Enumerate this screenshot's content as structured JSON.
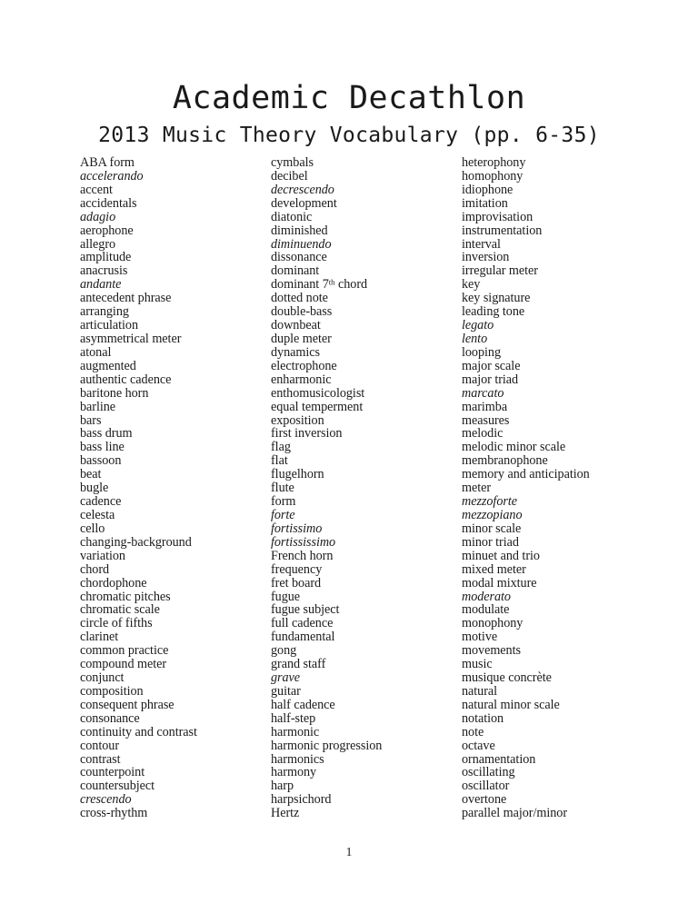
{
  "document": {
    "title": "Academic Decathlon",
    "subtitle": "2013 Music Theory Vocabulary (pp. 6-35)",
    "page_number": "1"
  },
  "columns": [
    {
      "name": "column-1",
      "terms": [
        {
          "text": "ABA form",
          "italic": false
        },
        {
          "text": "accelerando",
          "italic": true
        },
        {
          "text": "accent",
          "italic": false
        },
        {
          "text": "accidentals",
          "italic": false
        },
        {
          "text": "adagio",
          "italic": true
        },
        {
          "text": "aerophone",
          "italic": false
        },
        {
          "text": "allegro",
          "italic": false
        },
        {
          "text": "amplitude",
          "italic": false
        },
        {
          "text": "anacrusis",
          "italic": false
        },
        {
          "text": "andante",
          "italic": true
        },
        {
          "text": "antecedent phrase",
          "italic": false
        },
        {
          "text": "arranging",
          "italic": false
        },
        {
          "text": "articulation",
          "italic": false
        },
        {
          "text": "asymmetrical meter",
          "italic": false
        },
        {
          "text": "atonal",
          "italic": false
        },
        {
          "text": "augmented",
          "italic": false
        },
        {
          "text": "authentic cadence",
          "italic": false
        },
        {
          "text": "baritone horn",
          "italic": false
        },
        {
          "text": "barline",
          "italic": false
        },
        {
          "text": "bars",
          "italic": false
        },
        {
          "text": "bass drum",
          "italic": false
        },
        {
          "text": "bass line",
          "italic": false
        },
        {
          "text": "bassoon",
          "italic": false
        },
        {
          "text": "beat",
          "italic": false
        },
        {
          "text": "bugle",
          "italic": false
        },
        {
          "text": "cadence",
          "italic": false
        },
        {
          "text": "celesta",
          "italic": false
        },
        {
          "text": "cello",
          "italic": false
        },
        {
          "text": "changing-background",
          "italic": false
        },
        {
          "text": "variation",
          "italic": false
        },
        {
          "text": "chord",
          "italic": false
        },
        {
          "text": "chordophone",
          "italic": false
        },
        {
          "text": "chromatic pitches",
          "italic": false
        },
        {
          "text": "chromatic scale",
          "italic": false
        },
        {
          "text": "circle of fifths",
          "italic": false
        },
        {
          "text": "clarinet",
          "italic": false
        },
        {
          "text": "common practice",
          "italic": false
        },
        {
          "text": "compound meter",
          "italic": false
        },
        {
          "text": "conjunct",
          "italic": false
        },
        {
          "text": "composition",
          "italic": false
        },
        {
          "text": "consequent phrase",
          "italic": false
        },
        {
          "text": "consonance",
          "italic": false
        },
        {
          "text": "continuity and contrast",
          "italic": false
        },
        {
          "text": "contour",
          "italic": false
        },
        {
          "text": "contrast",
          "italic": false
        },
        {
          "text": "counterpoint",
          "italic": false
        },
        {
          "text": "countersubject",
          "italic": false
        },
        {
          "text": "crescendo",
          "italic": true
        },
        {
          "text": "cross-rhythm",
          "italic": false
        }
      ]
    },
    {
      "name": "column-2",
      "terms": [
        {
          "text": "cymbals",
          "italic": false
        },
        {
          "text": "decibel",
          "italic": false
        },
        {
          "text": "decrescendo",
          "italic": true
        },
        {
          "text": "development",
          "italic": false
        },
        {
          "text": "diatonic",
          "italic": false
        },
        {
          "text": "diminished",
          "italic": false
        },
        {
          "text": "diminuendo",
          "italic": true
        },
        {
          "text": "dissonance",
          "italic": false
        },
        {
          "text": "dominant",
          "italic": false
        },
        {
          "text": "dominant 7th chord",
          "italic": false,
          "superscript": {
            "before": "dominant 7",
            "sup": "th",
            "after": " chord"
          }
        },
        {
          "text": "dotted note",
          "italic": false
        },
        {
          "text": "double-bass",
          "italic": false
        },
        {
          "text": "downbeat",
          "italic": false
        },
        {
          "text": "duple meter",
          "italic": false
        },
        {
          "text": "dynamics",
          "italic": false
        },
        {
          "text": "electrophone",
          "italic": false
        },
        {
          "text": "enharmonic",
          "italic": false
        },
        {
          "text": "enthomusicologist",
          "italic": false
        },
        {
          "text": "equal temperment",
          "italic": false
        },
        {
          "text": "exposition",
          "italic": false
        },
        {
          "text": "first inversion",
          "italic": false
        },
        {
          "text": "flag",
          "italic": false
        },
        {
          "text": "flat",
          "italic": false
        },
        {
          "text": "flugelhorn",
          "italic": false
        },
        {
          "text": "flute",
          "italic": false
        },
        {
          "text": "form",
          "italic": false
        },
        {
          "text": "forte",
          "italic": true
        },
        {
          "text": "fortissimo",
          "italic": true
        },
        {
          "text": "fortississimo",
          "italic": true
        },
        {
          "text": "French horn",
          "italic": false
        },
        {
          "text": "frequency",
          "italic": false
        },
        {
          "text": "fret board",
          "italic": false
        },
        {
          "text": "fugue",
          "italic": false
        },
        {
          "text": "fugue subject",
          "italic": false
        },
        {
          "text": "full cadence",
          "italic": false
        },
        {
          "text": "fundamental",
          "italic": false
        },
        {
          "text": "gong",
          "italic": false
        },
        {
          "text": "grand staff",
          "italic": false
        },
        {
          "text": "grave",
          "italic": true
        },
        {
          "text": "guitar",
          "italic": false
        },
        {
          "text": "half cadence",
          "italic": false
        },
        {
          "text": "half-step",
          "italic": false
        },
        {
          "text": "harmonic",
          "italic": false
        },
        {
          "text": "harmonic progression",
          "italic": false
        },
        {
          "text": "harmonics",
          "italic": false
        },
        {
          "text": "harmony",
          "italic": false
        },
        {
          "text": "harp",
          "italic": false
        },
        {
          "text": "harpsichord",
          "italic": false
        },
        {
          "text": "Hertz",
          "italic": false
        }
      ]
    },
    {
      "name": "column-3",
      "terms": [
        {
          "text": "heterophony",
          "italic": false
        },
        {
          "text": "homophony",
          "italic": false
        },
        {
          "text": "idiophone",
          "italic": false
        },
        {
          "text": "imitation",
          "italic": false
        },
        {
          "text": "improvisation",
          "italic": false
        },
        {
          "text": "instrumentation",
          "italic": false
        },
        {
          "text": "interval",
          "italic": false
        },
        {
          "text": "inversion",
          "italic": false
        },
        {
          "text": "irregular meter",
          "italic": false
        },
        {
          "text": "key",
          "italic": false
        },
        {
          "text": "key signature",
          "italic": false
        },
        {
          "text": "leading tone",
          "italic": false
        },
        {
          "text": "legato",
          "italic": true
        },
        {
          "text": "lento",
          "italic": true
        },
        {
          "text": "looping",
          "italic": false
        },
        {
          "text": "major scale",
          "italic": false
        },
        {
          "text": "major triad",
          "italic": false
        },
        {
          "text": "marcato",
          "italic": true
        },
        {
          "text": "marimba",
          "italic": false
        },
        {
          "text": "measures",
          "italic": false
        },
        {
          "text": "melodic",
          "italic": false
        },
        {
          "text": "melodic minor scale",
          "italic": false
        },
        {
          "text": "membranophone",
          "italic": false
        },
        {
          "text": "memory and anticipation",
          "italic": false
        },
        {
          "text": "meter",
          "italic": false
        },
        {
          "text": "mezzoforte",
          "italic": true
        },
        {
          "text": "mezzopiano",
          "italic": true
        },
        {
          "text": "minor scale",
          "italic": false
        },
        {
          "text": "minor triad",
          "italic": false
        },
        {
          "text": "minuet and trio",
          "italic": false
        },
        {
          "text": "mixed meter",
          "italic": false
        },
        {
          "text": "modal mixture",
          "italic": false
        },
        {
          "text": "moderato",
          "italic": true
        },
        {
          "text": "modulate",
          "italic": false
        },
        {
          "text": "monophony",
          "italic": false
        },
        {
          "text": "motive",
          "italic": false
        },
        {
          "text": "movements",
          "italic": false
        },
        {
          "text": "music",
          "italic": false
        },
        {
          "text": "musique concrète",
          "italic": false
        },
        {
          "text": "natural",
          "italic": false
        },
        {
          "text": "natural minor scale",
          "italic": false
        },
        {
          "text": "notation",
          "italic": false
        },
        {
          "text": "note",
          "italic": false
        },
        {
          "text": "octave",
          "italic": false
        },
        {
          "text": "ornamentation",
          "italic": false
        },
        {
          "text": "oscillating",
          "italic": false
        },
        {
          "text": "oscillator",
          "italic": false
        },
        {
          "text": "overtone",
          "italic": false
        },
        {
          "text": "parallel major/minor",
          "italic": false
        }
      ]
    }
  ]
}
